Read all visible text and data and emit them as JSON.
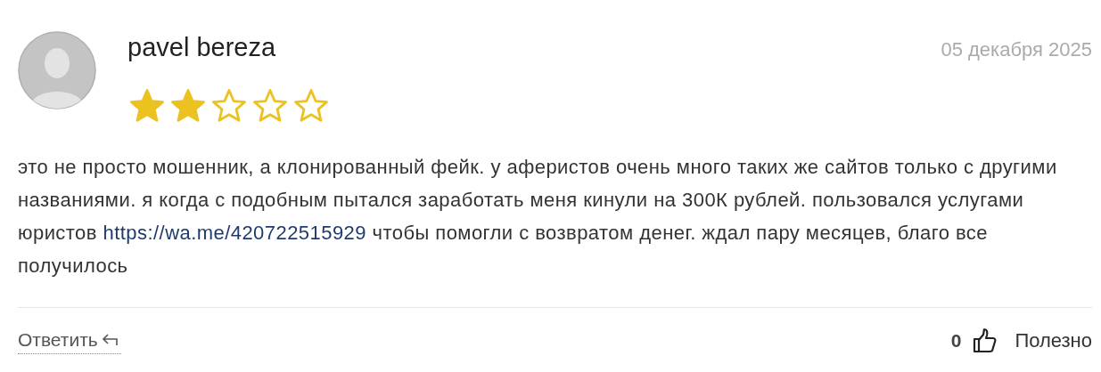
{
  "review": {
    "author": "pavel bereza",
    "date": "05 декабря 2025",
    "stars": 2,
    "body": {
      "before": "это не просто мошенник, а клонированный фейк. у аферистов очень много таких же сайтов только с другими названиями. я когда с подобным пытался заработать меня кинули на 300К рублей. пользовался услугами юристов ",
      "link": "https://wa.me/420722515929",
      "after": " чтобы помогли с возвратом денег. ждал пару месяцев, благо все получилось"
    },
    "reply_label": "Ответить",
    "helpful_count": "0",
    "helpful_label": "Полезно"
  }
}
